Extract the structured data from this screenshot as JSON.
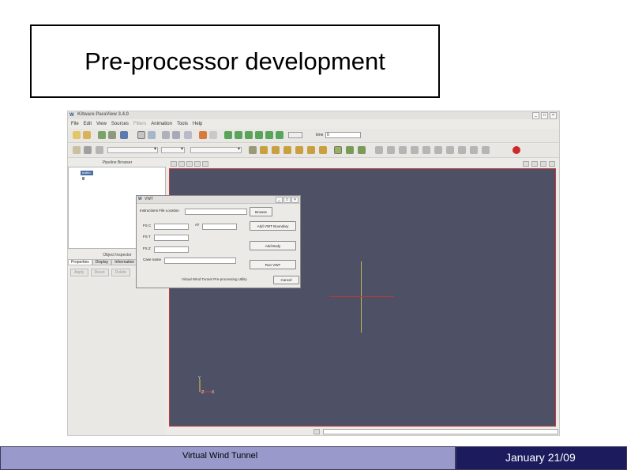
{
  "slide": {
    "title": "Pre-processor development",
    "footer_left": "Virtual Wind Tunnel",
    "footer_right": "January 21/09"
  },
  "app": {
    "title": "Kitware ParaView 3.4.0",
    "logo": "W",
    "window_controls": [
      "_",
      "□",
      "×"
    ],
    "menu": [
      {
        "label": "File",
        "enabled": true
      },
      {
        "label": "Edit",
        "enabled": true
      },
      {
        "label": "View",
        "enabled": true
      },
      {
        "label": "Sources",
        "enabled": true
      },
      {
        "label": "Filters",
        "enabled": false
      },
      {
        "label": "Animation",
        "enabled": true
      },
      {
        "label": "Tools",
        "enabled": true
      },
      {
        "label": "Help",
        "enabled": true
      }
    ],
    "time_label": "time",
    "time_value": "0",
    "pipeline_browser": "Pipeline Browser",
    "pipeline_item": "builtin:",
    "object_inspector": "Object Inspector",
    "tabs": [
      "Properties",
      "Display",
      "Information"
    ],
    "inspector_buttons": [
      "Apply",
      "Reset",
      "Delete"
    ],
    "accent_color": "#c63a3a",
    "viewport_color": "#4e5066"
  },
  "dialog": {
    "title": "VWT",
    "instructions_label": "Instructions File Location",
    "browse": "Browse",
    "fs_c": "FS C",
    "at": "AT",
    "fs_t": "FS T",
    "fs_z": "FS Z",
    "case_name": "Case name",
    "add_boundary": "Add VWT Boundary",
    "add_body": "Add Body",
    "run": "Run VWT",
    "cancel": "Cancel",
    "status": "Virtual Wind Tunnel Pre-processing Utility"
  }
}
